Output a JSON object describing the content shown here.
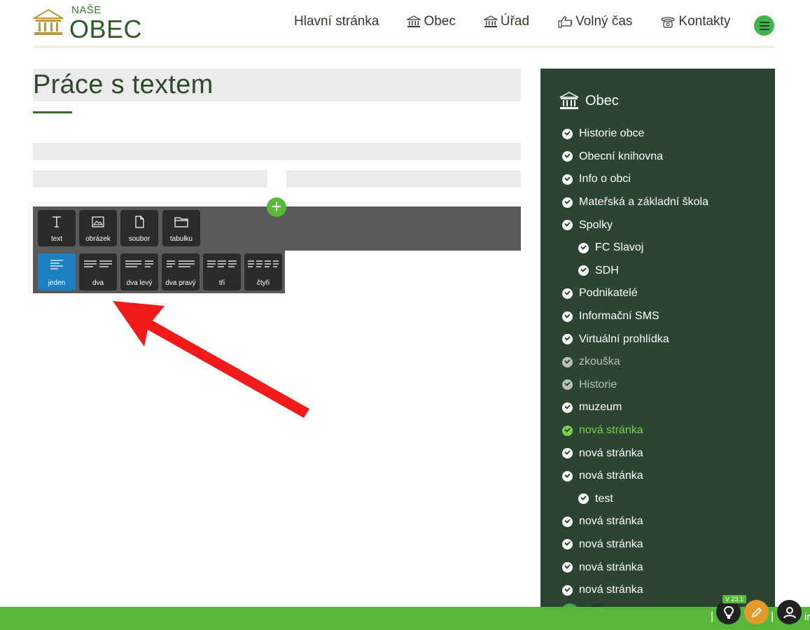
{
  "header": {
    "logo_small": "NAŠE",
    "logo_big": "OBEC",
    "nav": [
      {
        "label": "Hlavní stránka",
        "icon": ""
      },
      {
        "label": "Obec",
        "icon": "building-icon"
      },
      {
        "label": "Úřad",
        "icon": "building-icon"
      },
      {
        "label": "Volný čas",
        "icon": "thumbs-up-icon"
      },
      {
        "label": "Kontakty",
        "icon": "phone-icon"
      }
    ],
    "menu_icon": "hamburger-icon"
  },
  "main": {
    "title": "Práce s textem",
    "add_symbol": "+",
    "insert_tools": [
      {
        "label": "text",
        "icon": "text-icon"
      },
      {
        "label": "obrázek",
        "icon": "image-icon"
      },
      {
        "label": "soubor",
        "icon": "file-icon"
      },
      {
        "label": "tabulku",
        "icon": "folder-icon"
      }
    ],
    "layout_tools": [
      {
        "label": "jeden",
        "icon": "one-column-icon",
        "active": true
      },
      {
        "label": "dva",
        "icon": "two-columns-icon"
      },
      {
        "label": "dva levý",
        "icon": "two-left-icon"
      },
      {
        "label": "dva pravý",
        "icon": "two-right-icon"
      },
      {
        "label": "tři",
        "icon": "three-columns-icon"
      },
      {
        "label": "čtyři",
        "icon": "four-columns-icon"
      }
    ]
  },
  "sidebar": {
    "title": "Obec",
    "items": [
      {
        "label": "Historie obce"
      },
      {
        "label": "Obecní knihovna"
      },
      {
        "label": "Info o obci"
      },
      {
        "label": "Mateřská a základní škola"
      },
      {
        "label": "Spolky"
      },
      {
        "label": "FC Slavoj",
        "sub": true
      },
      {
        "label": "SDH",
        "sub": true
      },
      {
        "label": "Podnikatelé"
      },
      {
        "label": "Informační SMS"
      },
      {
        "label": "Virtuální prohlídka"
      },
      {
        "label": "zkouška",
        "state": "dim"
      },
      {
        "label": "Historie",
        "state": "dim"
      },
      {
        "label": "muzeum"
      },
      {
        "label": "nová stránka",
        "state": "active"
      },
      {
        "label": "nová stránka"
      },
      {
        "label": "nová stránka"
      },
      {
        "label": "test",
        "sub": true
      },
      {
        "label": "nová stránka"
      },
      {
        "label": "nová stránka"
      },
      {
        "label": "nová stránka"
      },
      {
        "label": "nová stránka"
      }
    ]
  },
  "footer": {
    "version": "V 23.1",
    "separator": "|",
    "text": "ir"
  },
  "colors": {
    "accent_green": "#57b73a",
    "sidebar_bg": "#2c4532",
    "active_blue": "#1c7fc0",
    "arrow_red": "#f01a1a"
  }
}
